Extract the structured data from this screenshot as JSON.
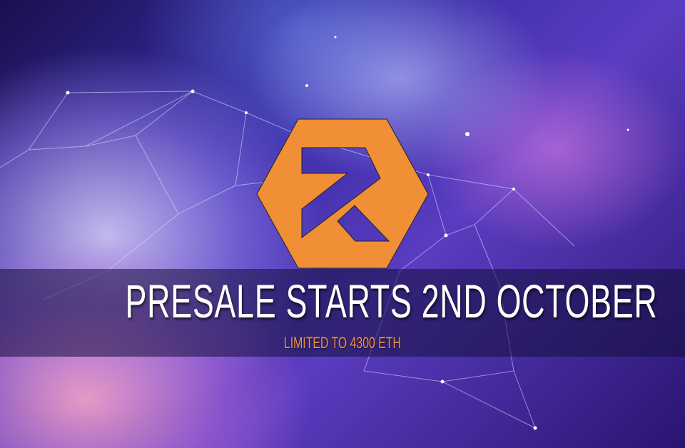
{
  "banner": {
    "title": "PRESALE STARTS 2ND OCTOBER",
    "subtitle": "LIMITED TO 4300 ETH"
  },
  "logo": {
    "name": "orange-hexagon-logo",
    "color": "#f08f35"
  },
  "colors": {
    "band": "#140e3c",
    "accent": "#f0913a"
  }
}
